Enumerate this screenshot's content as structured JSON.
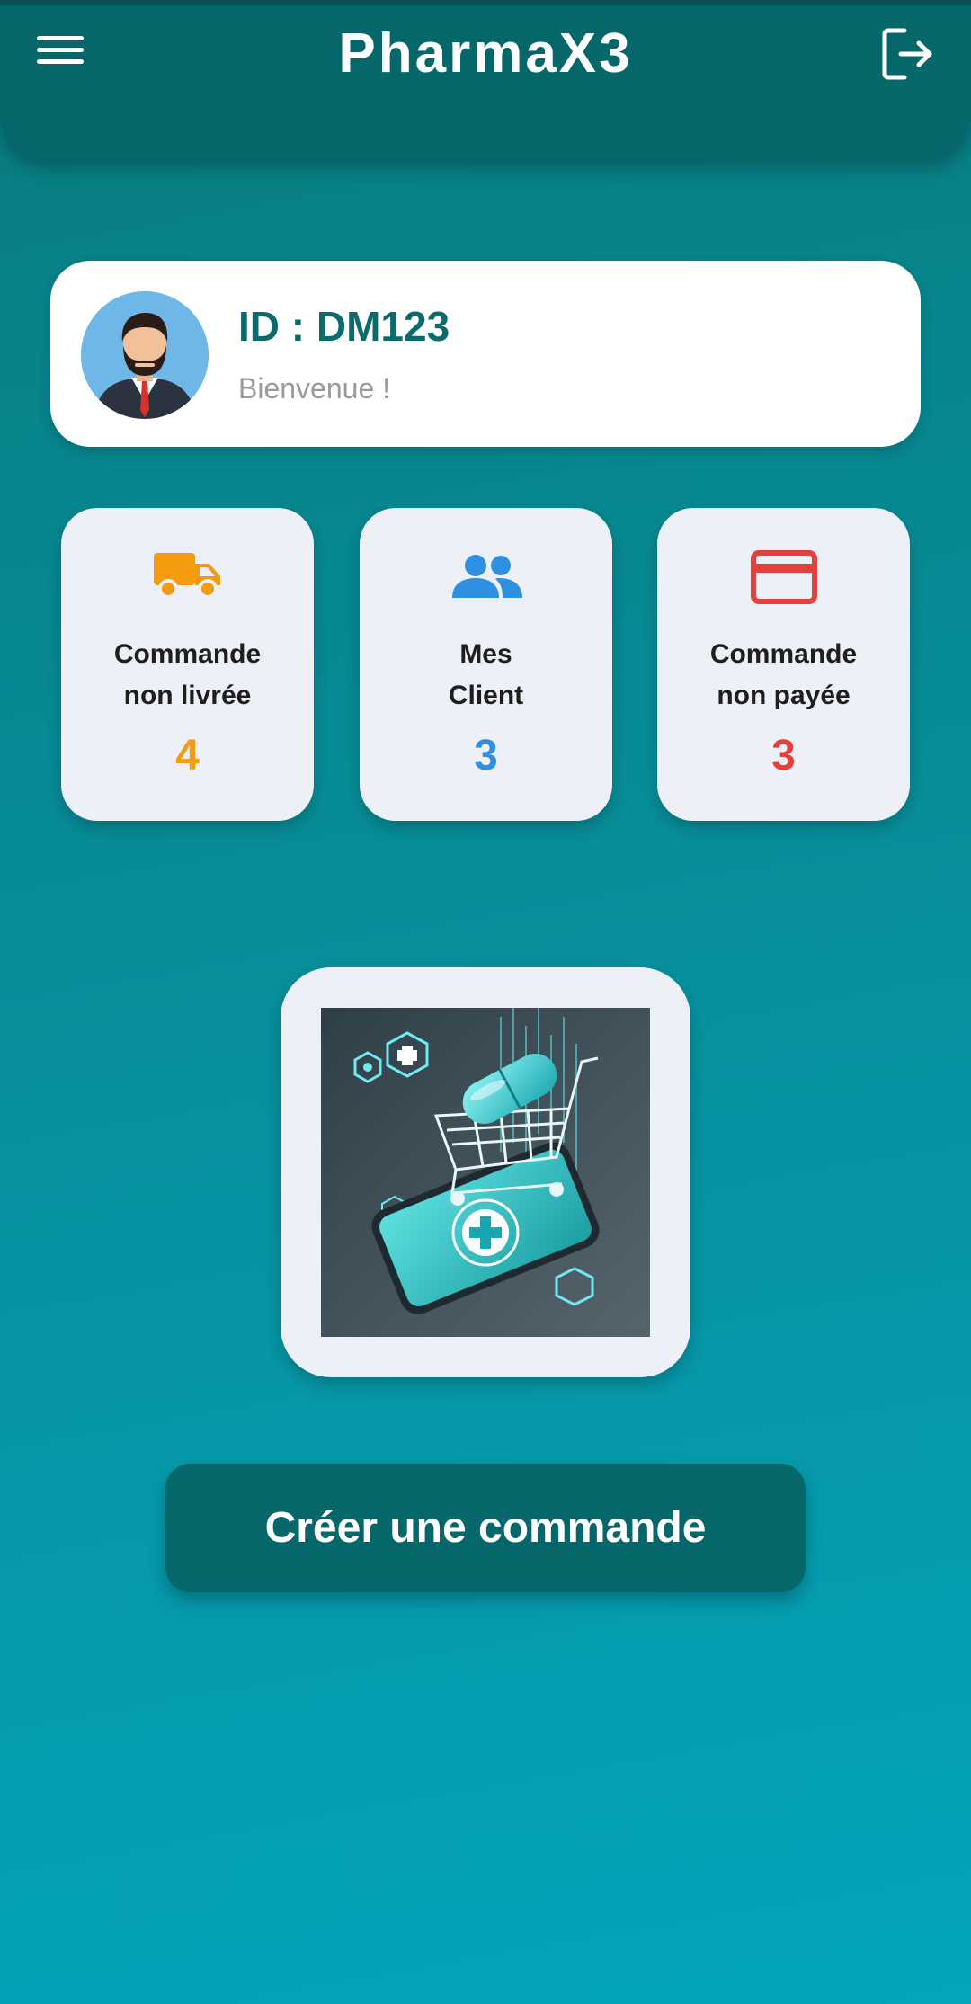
{
  "app": {
    "title": "PharmaX3"
  },
  "profile": {
    "id_text": "ID : DM123",
    "welcome": "Bienvenue !"
  },
  "stats": [
    {
      "icon": "truck-icon",
      "label_line1": "Commande",
      "label_line2": "non livrée",
      "count": "4",
      "color": "#f39a0e"
    },
    {
      "icon": "people-icon",
      "label_line1": "Mes",
      "label_line2": "Client",
      "count": "3",
      "color": "#2f8fe0"
    },
    {
      "icon": "credit-card-icon",
      "label_line1": "Commande",
      "label_line2": "non payée",
      "count": "3",
      "color": "#e5403c"
    }
  ],
  "actions": {
    "create_order": "Créer une commande"
  },
  "colors": {
    "primary": "#06676a",
    "accent": "#0b6b6c",
    "card_bg": "#eef0f8"
  }
}
